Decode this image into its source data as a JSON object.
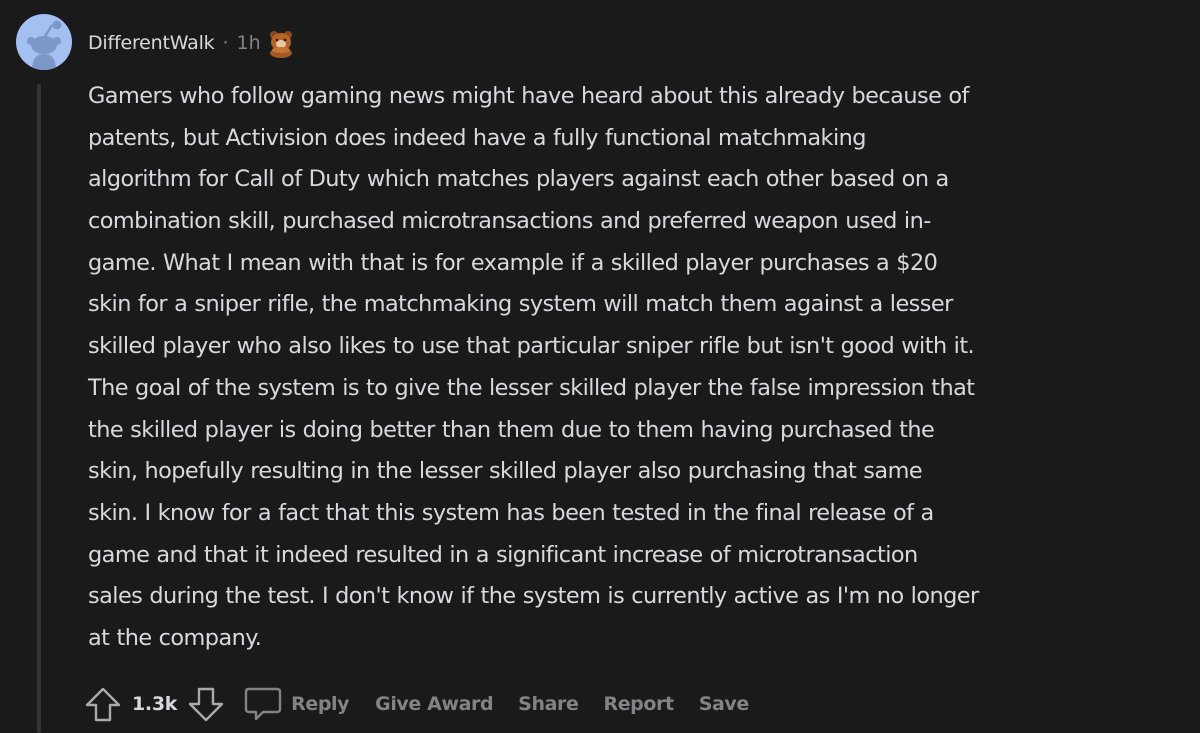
{
  "comment": {
    "author": "DifferentWalk",
    "separator": "·",
    "time": "1h",
    "award_icon": "bear-award-icon",
    "avatar_color": "#a4bff2",
    "body_lines": [
      "Gamers who follow gaming news might have heard about this already because of",
      "patents, but Activision does indeed have a fully functional matchmaking",
      "algorithm for Call of Duty which matches players against each other based on a",
      "combination skill, purchased microtransactions and preferred weapon used in-",
      "game. What I mean with that is for example if a skilled player purchases a $20",
      "skin for a sniper rifle, the matchmaking system will match them against a lesser",
      "skilled player who also likes to use that particular sniper rifle but isn't good with it.",
      "The goal of the system is to give the lesser skilled player the false impression that",
      "the skilled player is doing better than them due to them having purchased the",
      "skin, hopefully resulting in the lesser skilled player also purchasing that same",
      "skin. I know for a fact that this system has been tested in the final release of a",
      "game and that it indeed resulted in a significant increase of microtransaction",
      "sales during the test. I don't know if the system is currently active as I'm no longer",
      "at the company."
    ]
  },
  "actions": {
    "score": "1.3k",
    "upvote_icon": "upvote-arrow-icon",
    "downvote_icon": "downvote-arrow-icon",
    "comment_icon": "comment-bubble-icon",
    "reply": "Reply",
    "give_award": "Give Award",
    "share": "Share",
    "report": "Report",
    "save": "Save"
  },
  "colors": {
    "background": "#1a1a1b",
    "text": "#d7dadc",
    "muted": "#818384",
    "thread_line": "#343536"
  }
}
